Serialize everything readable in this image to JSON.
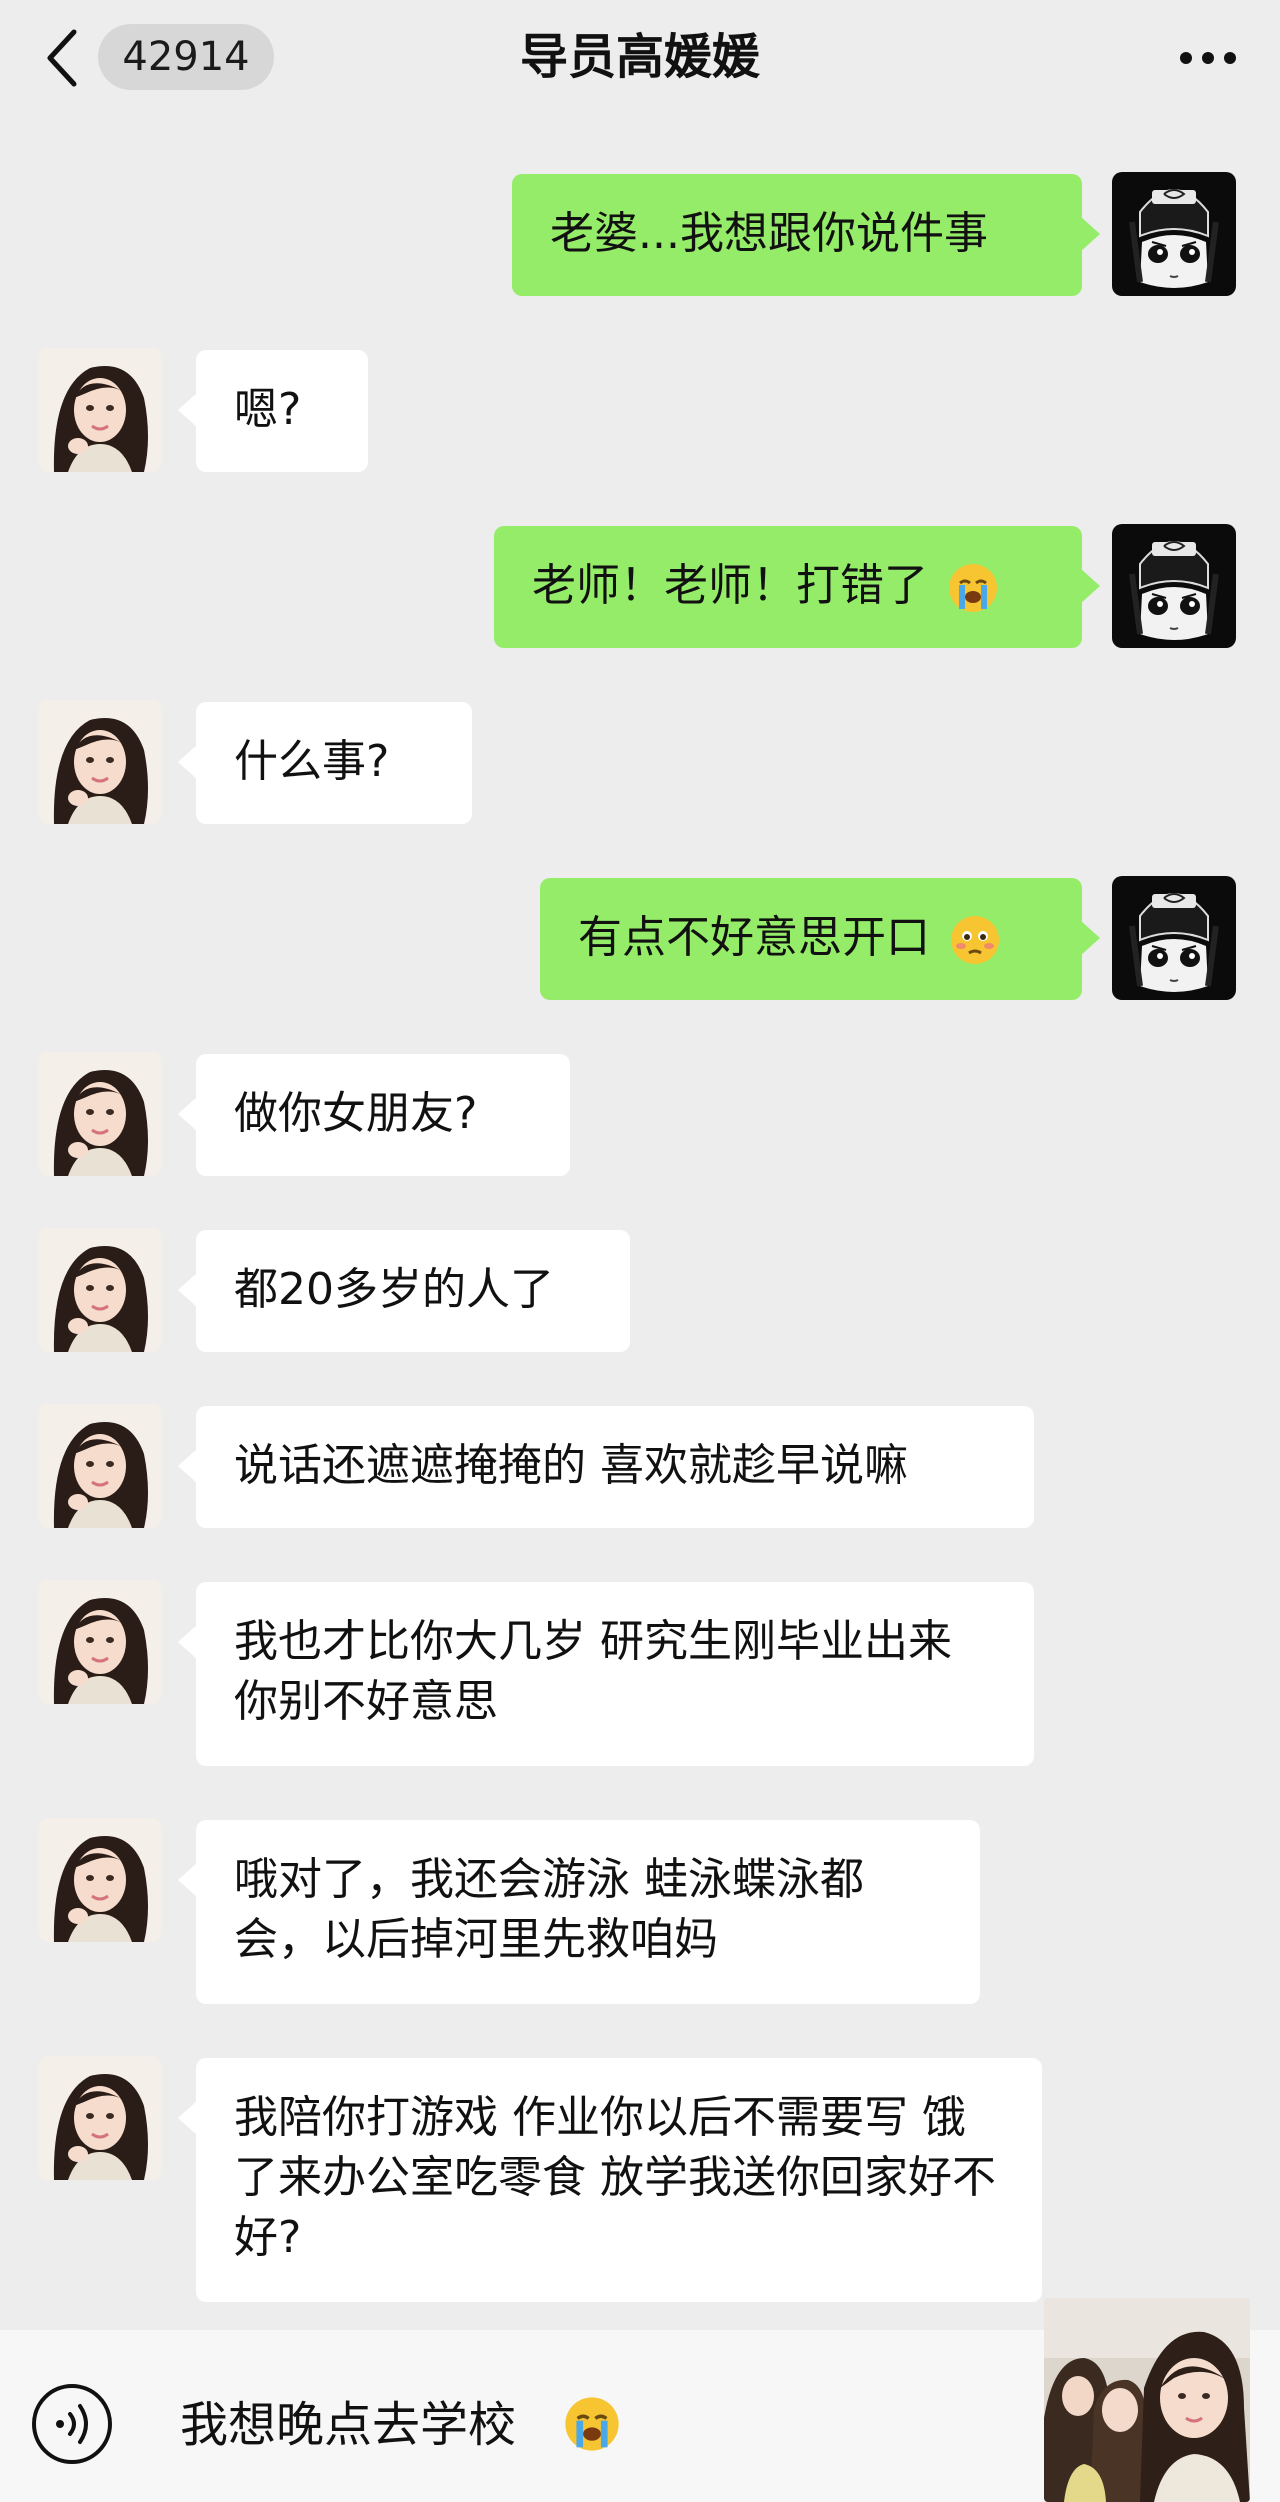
{
  "header": {
    "unread_count": "42914",
    "title": "导员高媛媛"
  },
  "messages": [
    {
      "side": "out",
      "text": "老婆...我想跟你说件事",
      "emoji": ""
    },
    {
      "side": "in",
      "text": "嗯?",
      "emoji": ""
    },
    {
      "side": "out",
      "text": "老师！老师！打错了",
      "emoji": "crying-emoji"
    },
    {
      "side": "in",
      "text": "什么事?",
      "emoji": ""
    },
    {
      "side": "out",
      "text": "有点不好意思开口",
      "emoji": "embarrassed-emoji"
    },
    {
      "side": "in",
      "text": "做你女朋友?",
      "emoji": ""
    },
    {
      "side": "in",
      "text": "都20多岁的人了",
      "emoji": ""
    },
    {
      "side": "in",
      "text": "说话还遮遮掩掩的 喜欢就趁早说嘛",
      "emoji": ""
    },
    {
      "side": "in",
      "text": "我也才比你大几岁 研究生刚毕业出来 你别不好意思",
      "emoji": ""
    },
    {
      "side": "in",
      "text": "哦对了，我还会游泳 蛙泳蝶泳都会，以后掉河里先救咱妈",
      "emoji": ""
    },
    {
      "side": "in",
      "text": "我陪你打游戏 作业你以后不需要写 饿了来办公室吃零食 放学我送你回家好不好?",
      "emoji": ""
    }
  ],
  "input_bar": {
    "draft_text": "我想晚点去学校",
    "draft_emoji": "crying-emoji"
  },
  "colors": {
    "background": "#ededed",
    "outgoing_bubble": "#95ec69",
    "incoming_bubble": "#ffffff"
  }
}
